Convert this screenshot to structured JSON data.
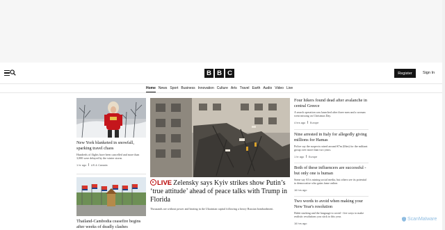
{
  "header": {
    "logo_letters": [
      "B",
      "B",
      "C"
    ],
    "register_label": "Register",
    "signin_label": "Sign In"
  },
  "nav": {
    "items": [
      {
        "label": "Home",
        "active": true
      },
      {
        "label": "News"
      },
      {
        "label": "Sport"
      },
      {
        "label": "Business"
      },
      {
        "label": "Innovation"
      },
      {
        "label": "Culture"
      },
      {
        "label": "Arts"
      },
      {
        "label": "Travel"
      },
      {
        "label": "Earth"
      },
      {
        "label": "Audio"
      },
      {
        "label": "Video"
      },
      {
        "label": "Live"
      }
    ]
  },
  "left_column": {
    "story1": {
      "headline": "New York blanketed in snowfall, sparking travel chaos",
      "summary": "Hundreds of flights have been cancelled and more than 3,000 were delayed by the winter storm.",
      "time": "1 hr ago",
      "category": "US & Canada"
    },
    "story2": {
      "headline": "Thailand-Cambodia ceasefire begins after weeks of deadly clashes"
    }
  },
  "lead": {
    "live_label": "LIVE",
    "headline": "Zelensky says Kyiv strikes show Putin’s ‘true attitude’ ahead of peace talks with Trump in Florida",
    "summary": "Thousands are without power and heating in the Ukrainian capital following a heavy Russian bombardment."
  },
  "right_column": {
    "stories": [
      {
        "headline": "Four hikers found dead after avalanche in central Greece",
        "summary": "A search operation was launched after three men and a woman went missing on Christmas Day.",
        "time": "4 hrs ago",
        "category": "Europe"
      },
      {
        "headline": "Nine arrested in Italy for allegedly giving millions for Hamas",
        "summary": "Police say the suspects raised around €7m (£6m) for the militant group over more than two years.",
        "time": "1 hr ago",
        "category": "Europe"
      },
      {
        "headline": "Both of these influencers are successful - but only one is human",
        "summary": "Some say AI is ruining social media, but others see its potential to democratise who gains fame online.",
        "time": "16 hrs ago",
        "category": ""
      },
      {
        "headline": "Two words to avoid when making your New Year's resolution",
        "summary": "Habit stacking and the language to avoid - five ways to make realistic resolutions you stick to this year.",
        "time": "16 hrs ago",
        "category": ""
      }
    ]
  },
  "watermark": {
    "text": "ScanMalware"
  },
  "colors": {
    "brand_black": "#141414",
    "live_red": "#b80000"
  }
}
